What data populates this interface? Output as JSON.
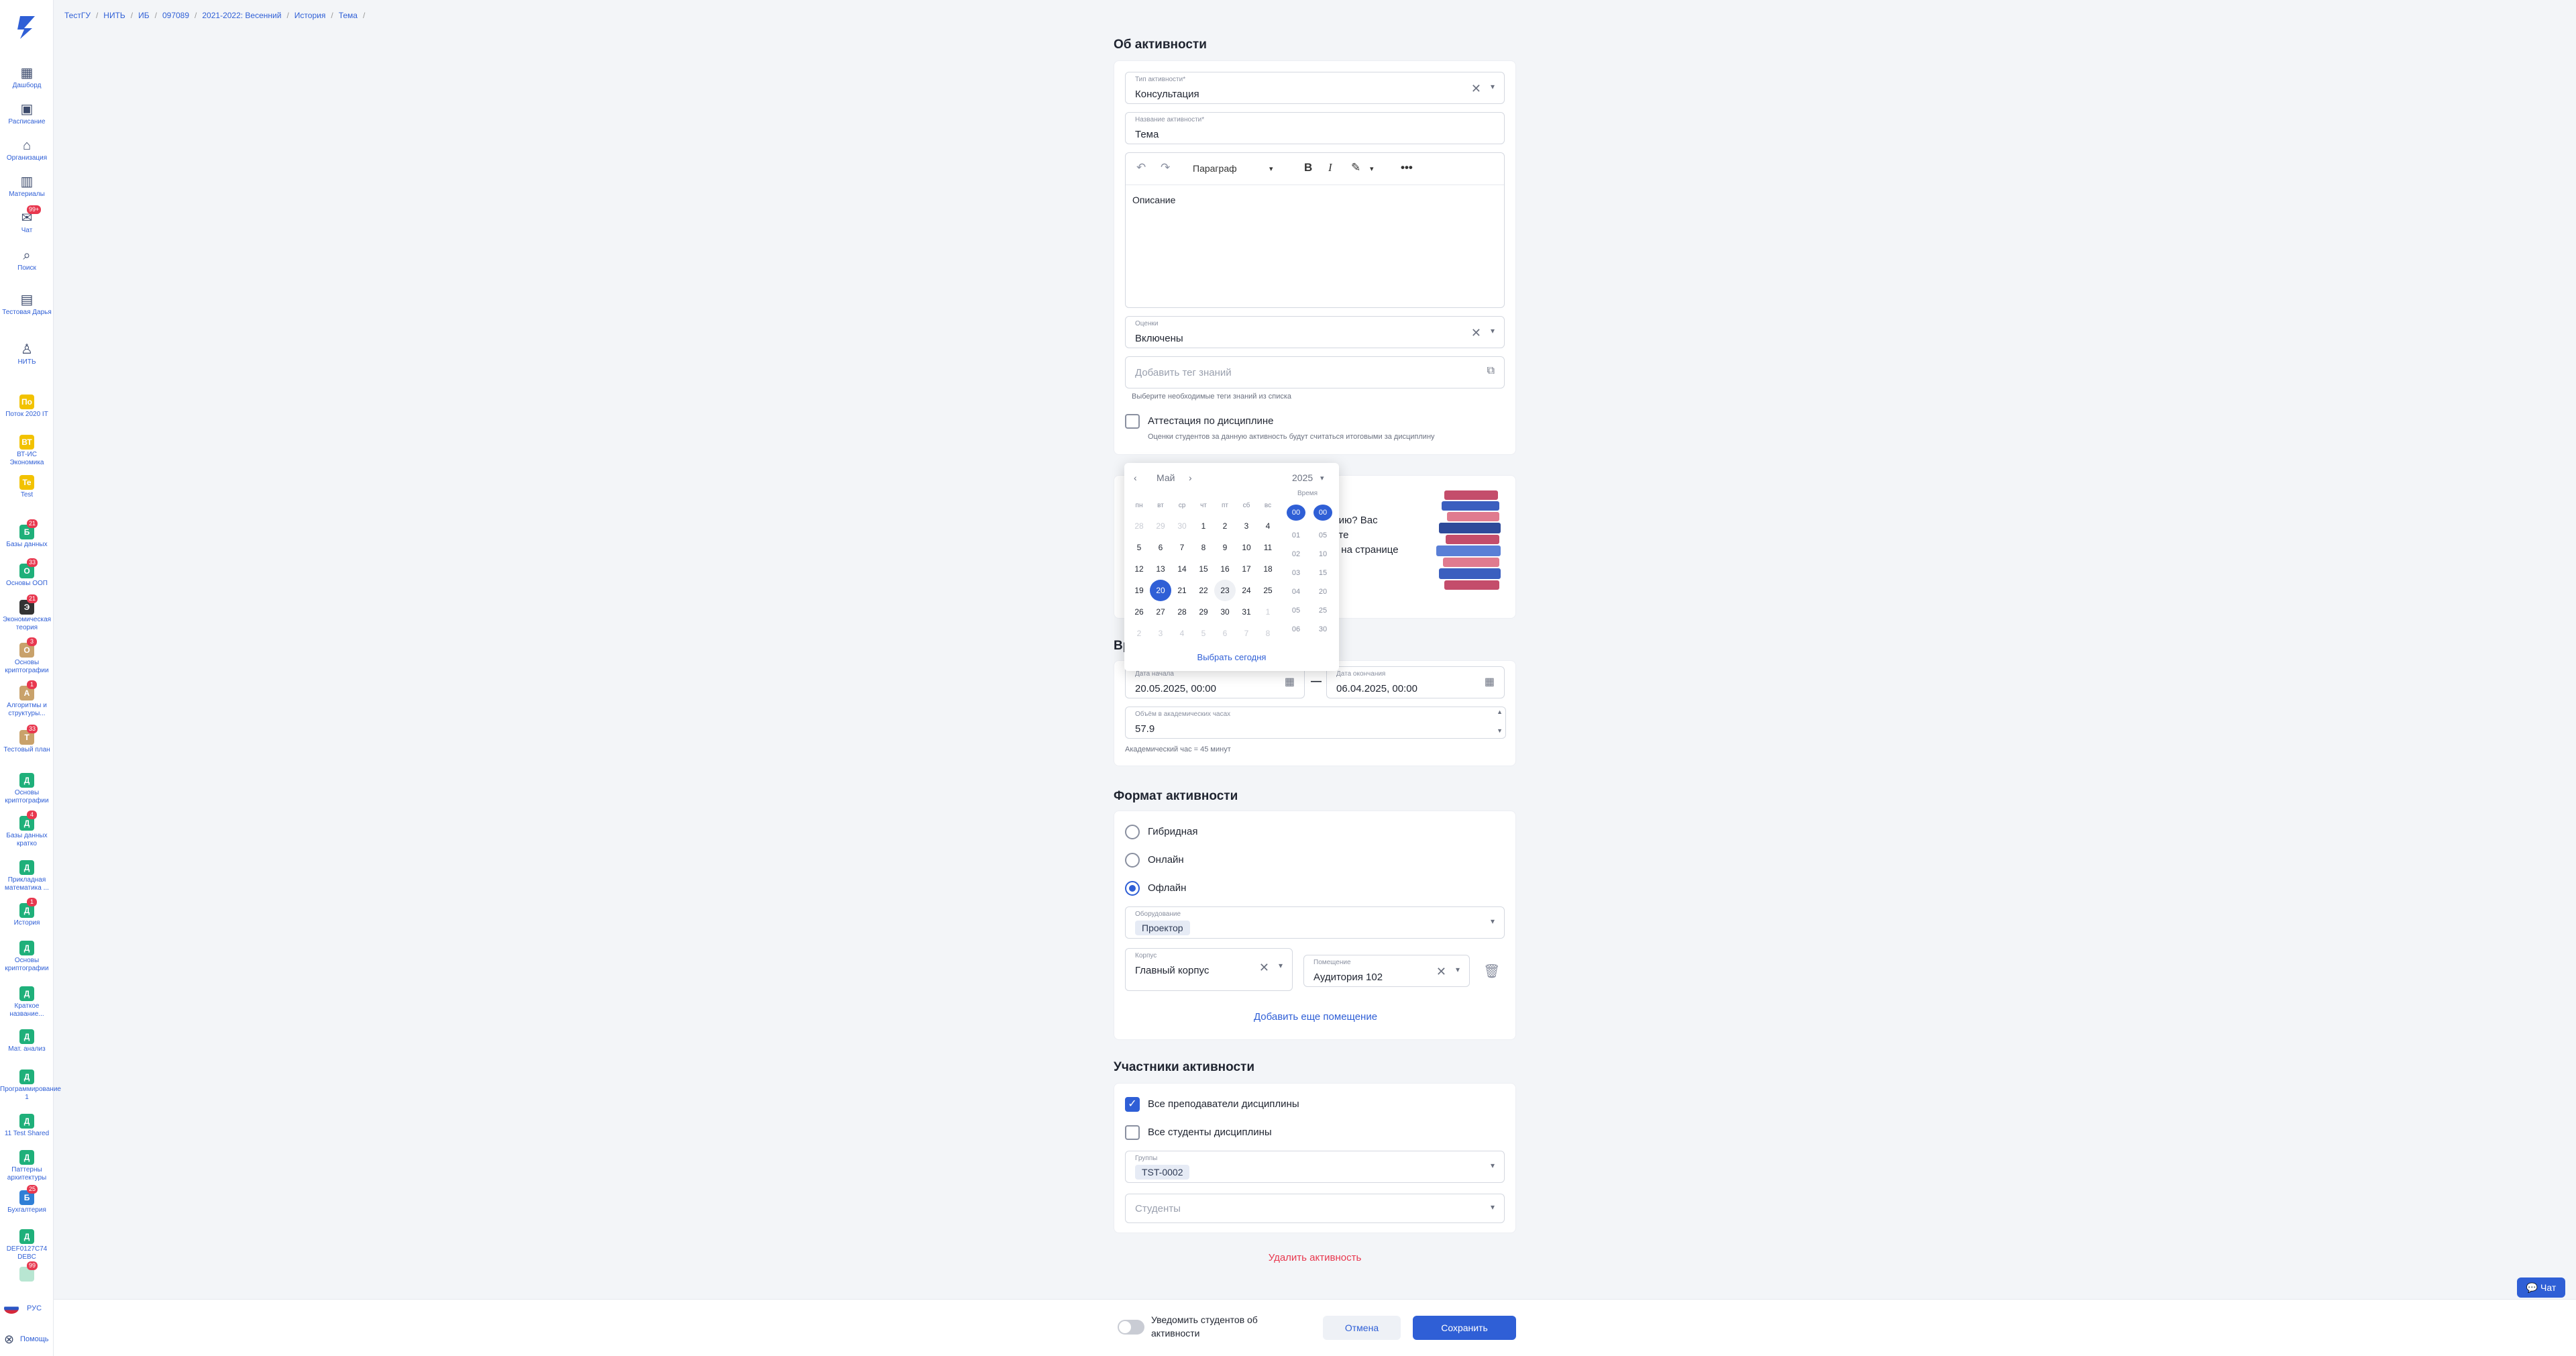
{
  "breadcrumbs": [
    "ТестГУ",
    "НИТЬ",
    "ИБ",
    "097089",
    "2021-2022: Весенний",
    "История",
    "Тема"
  ],
  "sidebar": {
    "nav": [
      {
        "label": "Дашборд",
        "icon": "grid-icon"
      },
      {
        "label": "Расписание",
        "icon": "calendar-icon"
      },
      {
        "label": "Организация",
        "icon": "home-icon"
      },
      {
        "label": "Материалы",
        "icon": "book-icon"
      },
      {
        "label": "Чат",
        "icon": "chat-icon",
        "badge": "99+"
      },
      {
        "label": "Поиск",
        "icon": "search-icon"
      },
      {
        "label": "Тестовая Дарья",
        "icon": "bag-icon"
      },
      {
        "label": "НИТЬ",
        "icon": "person-icon"
      }
    ],
    "courses": [
      {
        "label": "Поток 2020 IT",
        "avatar": "По",
        "color": "#f2c200",
        "badge": ""
      },
      {
        "label": "ВТ-ИС Экономика",
        "avatar": "ВТ",
        "color": "#f2c200",
        "badge": ""
      },
      {
        "label": "Test",
        "avatar": "Te",
        "color": "#f2c200",
        "badge": ""
      },
      {
        "label": "Базы данных",
        "avatar": "Б",
        "color": "#1fb07a",
        "badge": "21"
      },
      {
        "label": "Основы ООП",
        "avatar": "О",
        "color": "#1fb07a",
        "badge": "33"
      },
      {
        "label": "Экономическая теория",
        "avatar": "Э",
        "color": "#333333",
        "badge": "21"
      },
      {
        "label": "Основы криптографии",
        "avatar": "О",
        "color": "#c9a26b",
        "badge": "3"
      },
      {
        "label": "Алгоритмы и структуры...",
        "avatar": "А",
        "color": "#c9a26b",
        "badge": "1"
      },
      {
        "label": "Тестовый план",
        "avatar": "Т",
        "color": "#c9a26b",
        "badge": "33"
      },
      {
        "label": "Основы криптографии",
        "avatar": "Д",
        "color": "#1fb07a",
        "badge": ""
      },
      {
        "label": "Базы данных кратко",
        "avatar": "Д",
        "color": "#1fb07a",
        "badge": "4"
      },
      {
        "label": "Прикладная математика ...",
        "avatar": "Д",
        "color": "#1fb07a",
        "badge": ""
      },
      {
        "label": "История",
        "avatar": "Д",
        "color": "#1fb07a",
        "badge": "1"
      },
      {
        "label": "Основы криптографии",
        "avatar": "Д",
        "color": "#1fb07a",
        "badge": ""
      },
      {
        "label": "Краткое название...",
        "avatar": "Д",
        "color": "#1fb07a",
        "badge": ""
      },
      {
        "label": "Мат. анализ",
        "avatar": "Д",
        "color": "#1fb07a",
        "badge": ""
      },
      {
        "label": "Программирование 1",
        "avatar": "Д",
        "color": "#1fb07a",
        "badge": ""
      },
      {
        "label": "11 Test Shared",
        "avatar": "Д",
        "color": "#1fb07a",
        "badge": ""
      },
      {
        "label": "Паттерны архитектуры",
        "avatar": "Д",
        "color": "#1fb07a",
        "badge": ""
      },
      {
        "label": "Бухгалтерия",
        "avatar": "Б",
        "color": "#2f7fd6",
        "badge": "25"
      },
      {
        "label": "DEF0127С74 DEBC",
        "avatar": "Д",
        "color": "#1fb07a",
        "badge": ""
      },
      {
        "label": "",
        "avatar": "",
        "color": "#b8e6d2",
        "badge": "99"
      }
    ],
    "lang": "РУС",
    "help": "Помощь"
  },
  "about": {
    "title": "Об активности",
    "type_label": "Тип активности*",
    "type_value": "Консультация",
    "name_label": "Название активности*",
    "name_value": "Тема",
    "editor_paragraph": "Параграф",
    "editor_text": "Описание",
    "grades_label": "Оценки",
    "grades_value": "Включены",
    "tags_placeholder": "Добавить тег знаний",
    "tags_hint": "Выберите необходимые теги знаний из списка",
    "attest_label": "Аттестация по дисциплине",
    "attest_hint": "Оценки студентов за данную активность будут считаться итоговыми за дисциплину"
  },
  "promo": {
    "lines": [
      "цию? Вас",
      "ите",
      "я на странице"
    ]
  },
  "calendar": {
    "month": "Май",
    "year": "2025",
    "time_label": "Время",
    "weekdays": [
      "пн",
      "вт",
      "ср",
      "чт",
      "пт",
      "сб",
      "вс"
    ],
    "days": [
      [
        "28",
        "29",
        "30",
        "1",
        "2",
        "3",
        "4"
      ],
      [
        "5",
        "6",
        "7",
        "8",
        "9",
        "10",
        "11"
      ],
      [
        "12",
        "13",
        "14",
        "15",
        "16",
        "17",
        "18"
      ],
      [
        "19",
        "20",
        "21",
        "22",
        "23",
        "24",
        "25"
      ],
      [
        "26",
        "27",
        "28",
        "29",
        "30",
        "31",
        "1"
      ],
      [
        "2",
        "3",
        "4",
        "5",
        "6",
        "7",
        "8"
      ]
    ],
    "hours": [
      "00",
      "01",
      "02",
      "03",
      "04",
      "05",
      "06"
    ],
    "minutes": [
      "00",
      "05",
      "10",
      "15",
      "20",
      "25",
      "30"
    ],
    "today_button": "Выбрать сегодня"
  },
  "time": {
    "title_partial": "Вр",
    "start_label": "Дата начала",
    "start_value": "20.05.2025, 00:00",
    "end_label": "Дата окончания",
    "end_value": "06.04.2025, 00:00",
    "hours_label": "Объём в академических часах",
    "hours_value": "57.9",
    "hours_hint": "Академический час = 45 минут"
  },
  "format": {
    "title": "Формат активности",
    "options": [
      "Гибридная",
      "Онлайн",
      "Офлайн"
    ],
    "equipment_label": "Оборудование",
    "equipment_tag": "Проектор",
    "building_label": "Корпус",
    "building_value": "Главный корпус",
    "room_label": "Помещение",
    "room_value": "Аудитория 102",
    "add_room": "Добавить еще помещение"
  },
  "participants": {
    "title": "Участники активности",
    "all_teachers": "Все преподаватели дисциплины",
    "all_students": "Все студенты дисциплины",
    "groups_label": "Группы",
    "group_tag": "TST-0002",
    "students_placeholder": "Студенты"
  },
  "delete_activity": "Удалить активность",
  "bottom": {
    "notify": "Уведомить студентов об активности",
    "cancel": "Отмена",
    "save": "Сохранить"
  },
  "chat_fab": "Чат"
}
